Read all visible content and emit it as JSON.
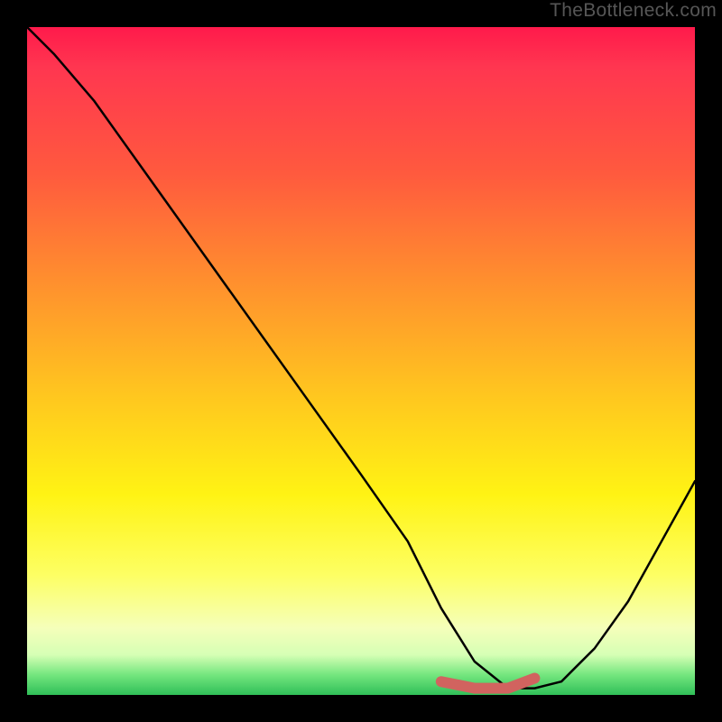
{
  "watermark": "TheBottleneck.com",
  "chart_data": {
    "type": "line",
    "title": "",
    "xlabel": "",
    "ylabel": "",
    "xlim": [
      0,
      100
    ],
    "ylim": [
      0,
      100
    ],
    "series": [
      {
        "name": "bottleneck-curve",
        "x": [
          0,
          4,
          10,
          20,
          30,
          40,
          50,
          57,
          62,
          67,
          72,
          76,
          80,
          85,
          90,
          95,
          100
        ],
        "values": [
          100,
          96,
          89,
          75,
          61,
          47,
          33,
          23,
          13,
          5,
          1,
          1,
          2,
          7,
          14,
          23,
          32
        ]
      },
      {
        "name": "optimal-flat-highlight",
        "x": [
          62,
          67,
          72,
          76
        ],
        "values": [
          2,
          1,
          1,
          2.5
        ]
      }
    ],
    "gradient_stops": [
      {
        "pos": 0,
        "color": "#ff1a4b"
      },
      {
        "pos": 6,
        "color": "#ff3650"
      },
      {
        "pos": 22,
        "color": "#ff5a3e"
      },
      {
        "pos": 38,
        "color": "#ff8f2e"
      },
      {
        "pos": 55,
        "color": "#ffc61f"
      },
      {
        "pos": 70,
        "color": "#fff314"
      },
      {
        "pos": 82,
        "color": "#fdff63"
      },
      {
        "pos": 90,
        "color": "#f5ffba"
      },
      {
        "pos": 94,
        "color": "#d6ffb5"
      },
      {
        "pos": 97,
        "color": "#74e67e"
      },
      {
        "pos": 100,
        "color": "#2fbf58"
      }
    ],
    "highlight_color": "#d1635f"
  }
}
